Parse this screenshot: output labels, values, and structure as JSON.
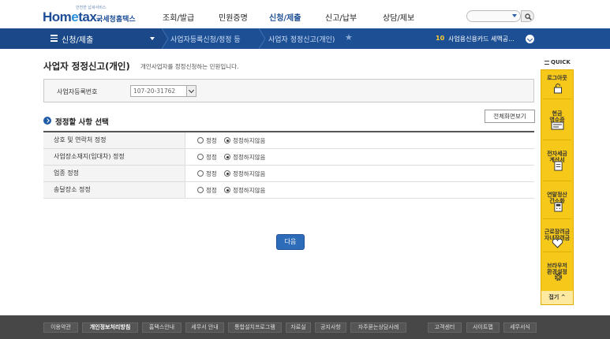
{
  "header": {
    "logo_small": "안전한 납세서비스",
    "logo_brand_1": "Hom",
    "logo_brand_2": "e",
    "logo_brand_3": "tax.",
    "logo_kr": "국세청홈택스",
    "menu": [
      "조회/발급",
      "민원증명",
      "신청/제출",
      "신고/납부",
      "상담/제보"
    ]
  },
  "navbar": {
    "main": "신청/제출",
    "crumb1": "사업자등록신청/정정 등",
    "crumb2": "사업자 정정신고(개인)",
    "notice_num": "10",
    "notice_text": "사업용신용카드 세액공..."
  },
  "page": {
    "title": "사업자 정정신고(개인)",
    "desc": "개인사업자를 정정신청하는 민원입니다.",
    "biz_label": "사업자등록번호",
    "biz_value": "107-20-31762",
    "section_title": "정정할 사항 선택",
    "fullview": "전체화면보기",
    "rows": [
      {
        "label": "상호 및 연락처 정정",
        "opt1": "정정",
        "opt2": "정정하지않음"
      },
      {
        "label": "사업장소재지(임대차) 정정",
        "opt1": "정정",
        "opt2": "정정하지않음"
      },
      {
        "label": "업종 정정",
        "opt1": "정정",
        "opt2": "정정하지않음"
      },
      {
        "label": "송달장소 정정",
        "opt1": "정정",
        "opt2": "정정하지않음"
      }
    ],
    "next": "다음"
  },
  "quick": {
    "title": "QUICK",
    "items": [
      {
        "label": "로그아웃"
      },
      {
        "label": "현금\n영수증"
      },
      {
        "label": "전자세금\n계산서"
      },
      {
        "label": "연말정산\n간소화"
      },
      {
        "label": "근로장려금\n자녀장려금"
      },
      {
        "label": "브라우저\n환경설정"
      }
    ],
    "close": "접기"
  },
  "footer": {
    "links": [
      "이용약관",
      "개인정보처리방침",
      "홈택스안내",
      "세무서 안내",
      "통합설치프로그램",
      "자료실",
      "공지사항",
      "자주묻는상담사례",
      "고객센터",
      "사이트맵",
      "세무서식"
    ]
  },
  "colors": {
    "brand": "#1d4f95",
    "quick_bar": "#f5c81a",
    "footer": "#474747"
  }
}
